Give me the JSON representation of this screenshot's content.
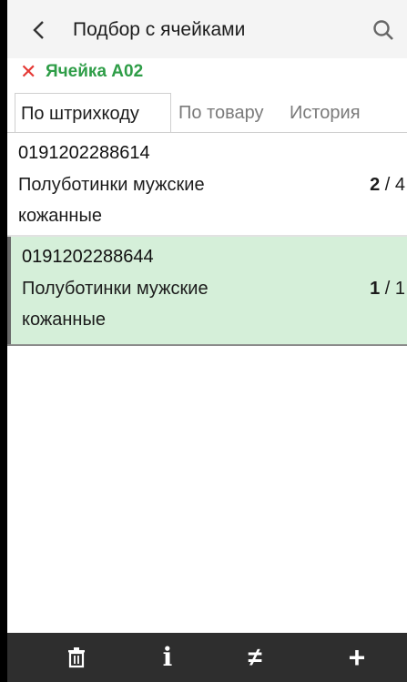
{
  "header": {
    "title": "Подбор с ячейками",
    "back_icon": "chevron-left-icon",
    "search_icon": "search-icon"
  },
  "cell": {
    "clear_icon": "close-icon",
    "label": "Ячейка A02",
    "clear_color": "#e53935",
    "label_color": "#2e9d47"
  },
  "tabs": [
    {
      "label": "По штрихкоду",
      "active": true
    },
    {
      "label": "По товару",
      "active": false
    },
    {
      "label": "История",
      "active": false
    }
  ],
  "items": [
    {
      "barcode": "0191202288614",
      "name": "Полуботинки мужские кожанные",
      "picked": "2",
      "sep": " / ",
      "total": "4",
      "selected": false
    },
    {
      "barcode": "0191202288644",
      "name": "Полуботинки мужские кожанные",
      "picked": "1",
      "sep": " / ",
      "total": "1",
      "selected": true
    }
  ],
  "bottom_bar": {
    "buttons": [
      {
        "icon": "trash-icon",
        "glyph": "🗑"
      },
      {
        "icon": "info-icon",
        "glyph": "i"
      },
      {
        "icon": "not-equal-icon",
        "glyph": "≠"
      },
      {
        "icon": "plus-icon",
        "glyph": "+"
      }
    ]
  },
  "colors": {
    "selected_row": "#d5efd9",
    "bottom_bar": "#2e2e2e"
  }
}
